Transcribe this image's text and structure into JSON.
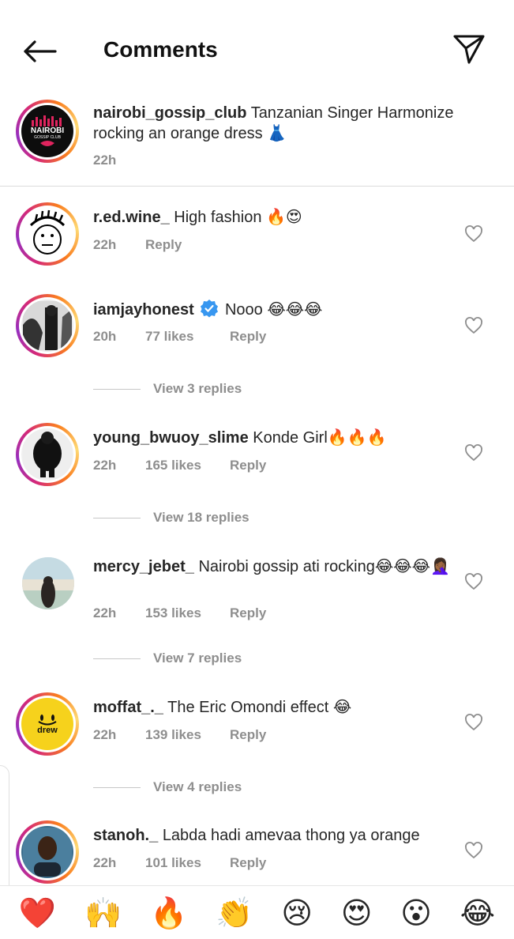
{
  "header": {
    "title": "Comments"
  },
  "caption": {
    "username": "nairobi_gossip_club",
    "text": "Tanzanian Singer Harmonize rocking an orange dress 👗",
    "time": "22h",
    "logo_text": "NAIROBI",
    "logo_sub": "GOSSIP CLUB"
  },
  "comments": [
    {
      "username": "r.ed.wine_",
      "text": "High fashion 🔥😍",
      "time": "22h",
      "likes": "",
      "reply": "Reply"
    },
    {
      "username": "iamjayhonest",
      "text": "Nooo 😂😂😂",
      "time": "20h",
      "likes": "77 likes",
      "reply": "Reply",
      "view_replies": "View 3 replies"
    },
    {
      "username": "young_bwuoy_slime",
      "text": "Konde Girl🔥🔥🔥",
      "time": "22h",
      "likes": "165 likes",
      "reply": "Reply",
      "view_replies": "View 18 replies"
    },
    {
      "username": "mercy_jebet_",
      "text": "Nairobi gossip ati rocking😂😂😂🤦🏾‍♀️",
      "time": "22h",
      "likes": "153 likes",
      "reply": "Reply",
      "view_replies": "View 7 replies"
    },
    {
      "username": "moffat_._",
      "text": "The Eric Omondi effect 😂",
      "time": "22h",
      "likes": "139 likes",
      "reply": "Reply",
      "view_replies": "View 4 replies",
      "avatar_text": "drew"
    },
    {
      "username": "stanoh._",
      "text": "Labda hadi amevaa thong ya orange",
      "time": "22h",
      "likes": "101 likes",
      "reply": "Reply"
    }
  ],
  "emoji_bar": [
    "❤️",
    "🙌",
    "🔥",
    "👏",
    "😢",
    "😍",
    "😮",
    "😂"
  ],
  "colors": {
    "accent": "#3897f0",
    "muted": "#8e8e8e",
    "text": "#262626",
    "heart": "#e0245e"
  }
}
